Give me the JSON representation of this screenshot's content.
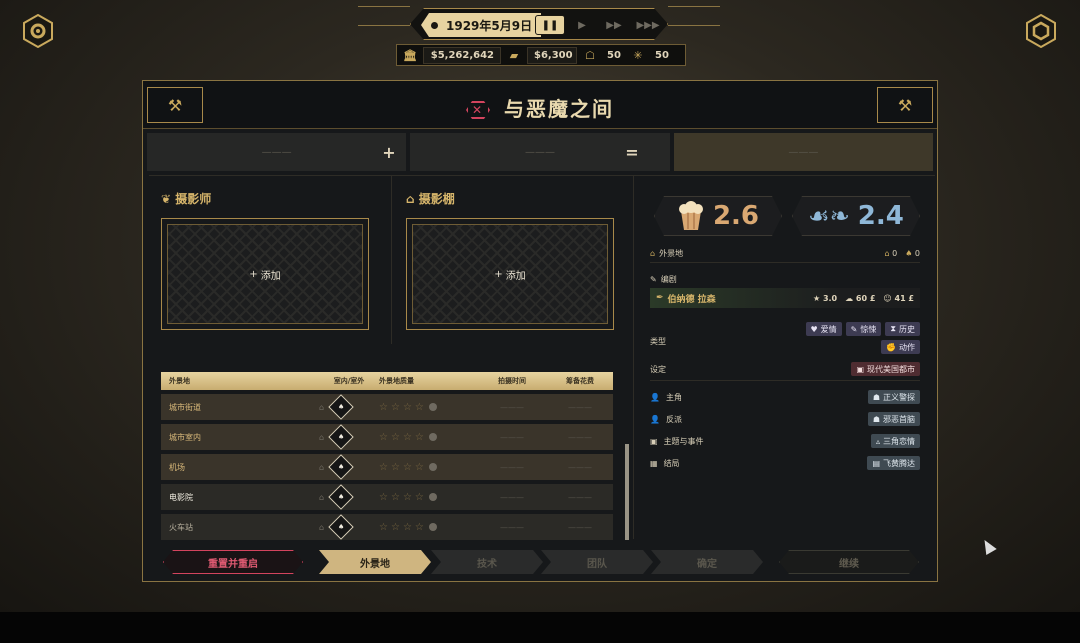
{
  "hud": {
    "date": "1929年5月9日",
    "pause": "❚❚",
    "play": "▶",
    "fast": "▶▶",
    "fastest": "▶▶▶",
    "money": "$5,262,642",
    "cash2": "$6,300",
    "stat3": "50",
    "stat4": "50"
  },
  "panel": {
    "title": "与恶魔之间",
    "formula_placeholder": "———"
  },
  "slots": {
    "photographer": {
      "label": "摄影师",
      "add": "添加"
    },
    "studio": {
      "label": "摄影棚",
      "add": "添加"
    }
  },
  "locations": {
    "headers": [
      "外景地",
      "室内/室外",
      "外景地质量",
      "拍摄时间",
      "筹备花费"
    ],
    "rows": [
      {
        "name": "城市街道",
        "time": "———",
        "cost": "———"
      },
      {
        "name": "城市室内",
        "time": "———",
        "cost": "———"
      },
      {
        "name": "机场",
        "time": "———",
        "cost": "———"
      },
      {
        "name": "电影院",
        "time": "———",
        "cost": "———"
      },
      {
        "name": "火车站",
        "time": "———",
        "cost": "———"
      }
    ]
  },
  "right": {
    "score_gold": "2.6",
    "score_blue": "2.4",
    "location_label": "外景地",
    "location_counts": [
      "0",
      "0"
    ],
    "writer_label": "编剧",
    "writer_name": "伯纳德 拉森",
    "writer_stats": [
      "3.0",
      "60 £",
      "41 £"
    ],
    "genre_label": "类型",
    "genres": [
      "爱情",
      "惊悚",
      "历史",
      "动作"
    ],
    "setting_label": "设定",
    "setting": "现代美国都市",
    "lead_label": "主角",
    "lead": "正义警探",
    "villain_label": "反派",
    "villain": "邪恶首脑",
    "theme_label": "主题与事件",
    "theme": "三角恋情",
    "ending_label": "结局",
    "ending": "飞黄腾达"
  },
  "nav": {
    "reset": "重置并重启",
    "steps": [
      "外景地",
      "技术",
      "团队",
      "确定"
    ],
    "continue": "继续"
  },
  "colors": {
    "accent_gold": "#c9a95d",
    "accent_red": "#d3445e",
    "score_gold": "#d9a872",
    "score_blue": "#8fb8d8"
  }
}
